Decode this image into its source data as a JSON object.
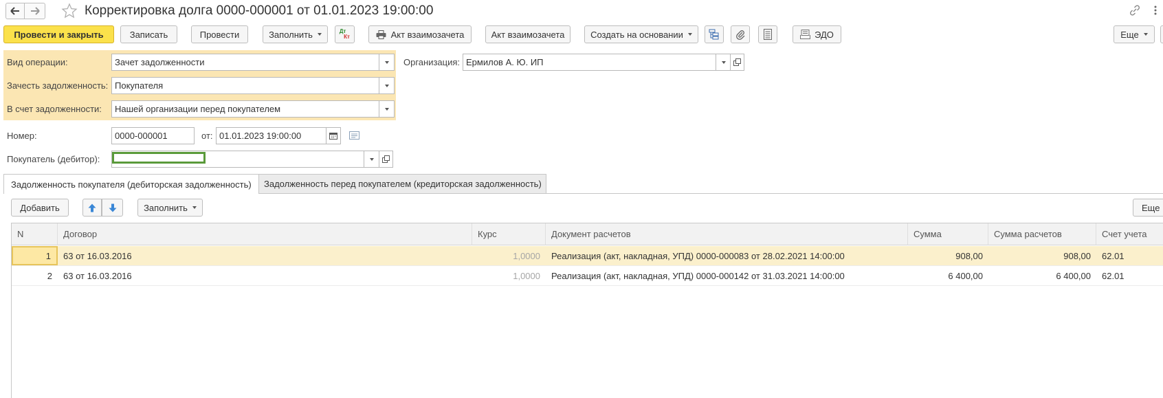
{
  "window": {
    "title": "Корректировка долга 0000-000001 от 01.01.2023 19:00:00",
    "icons": [
      "back-arrow-icon",
      "forward-arrow-icon",
      "star-icon",
      "link-icon",
      "more-vert-icon"
    ]
  },
  "toolbar": {
    "post_and_close": "Провести и закрыть",
    "save": "Записать",
    "post": "Провести",
    "fill": "Заполнить",
    "dt_kt_top": "Дт",
    "dt_kt_bottom": "Кт",
    "print_act": "Акт взаимозачета",
    "act": "Акт взаимозачета",
    "create_based_on": "Создать на основании",
    "edo": "ЭДО",
    "more": "Еще"
  },
  "form": {
    "operation_label": "Вид операции:",
    "operation_value": "Зачет задолженности",
    "offset_label": "Зачесть задолженность:",
    "offset_value": "Покупателя",
    "against_label": "В счет задолженности:",
    "against_value": "Нашей организации перед покупателем",
    "organization_label": "Организация:",
    "organization_value": "Ермилов А. Ю. ИП",
    "number_label": "Номер:",
    "number_value": "0000-000001",
    "date_label": "от:",
    "date_value": "01.01.2023 19:00:00",
    "buyer_label": "Покупатель (дебитор):",
    "buyer_value": ""
  },
  "tabs": [
    {
      "label": "Задолженность покупателя (дебиторская задолженность)",
      "active": true
    },
    {
      "label": "Задолженность перед покупателем (кредиторская задолженность)",
      "active": false
    }
  ],
  "table_toolbar": {
    "add": "Добавить",
    "fill": "Заполнить",
    "more": "Еще"
  },
  "table": {
    "columns": [
      "N",
      "Договор",
      "Курс",
      "Документ расчетов",
      "Сумма",
      "Сумма расчетов",
      "Счет учета"
    ],
    "rows": [
      {
        "n": "1",
        "contract": "63 от 16.03.2016",
        "rate": "1,0000",
        "document": "Реализация (акт, накладная, УПД) 0000-000083 от 28.02.2021 14:00:00",
        "sum": "908,00",
        "settlement_sum": "908,00",
        "account": "62.01",
        "selected": true
      },
      {
        "n": "2",
        "contract": "63 от 16.03.2016",
        "rate": "1,0000",
        "document": "Реализация (акт, накладная, УПД) 0000-000142 от 31.03.2021 14:00:00",
        "sum": "6 400,00",
        "settlement_sum": "6 400,00",
        "account": "62.01",
        "selected": false
      }
    ]
  },
  "colors": {
    "primary_button": "#fbe14b",
    "highlight_section": "#fbe6b3",
    "selected_row": "#fbf0cc",
    "focus_border": "#5a9a3a"
  }
}
